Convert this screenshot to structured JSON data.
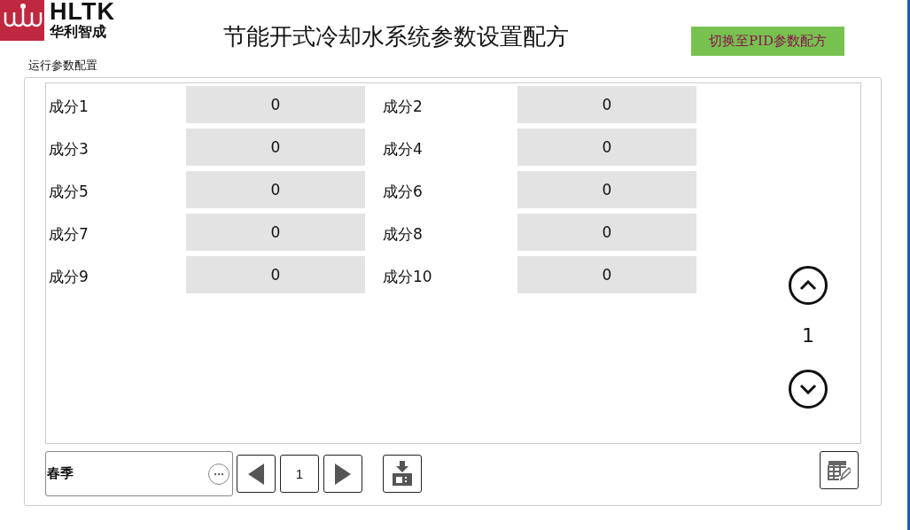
{
  "logo": {
    "brand": "HLTK",
    "subtitle": "华利智成"
  },
  "title": "节能开式冷却水系统参数设置配方",
  "switch_button": "切换至PID参数配方",
  "section_label": "运行参数配置",
  "params": [
    {
      "label": "成分1",
      "value": "0"
    },
    {
      "label": "成分2",
      "value": "0"
    },
    {
      "label": "成分3",
      "value": "0"
    },
    {
      "label": "成分4",
      "value": "0"
    },
    {
      "label": "成分5",
      "value": "0"
    },
    {
      "label": "成分6",
      "value": "0"
    },
    {
      "label": "成分7",
      "value": "0"
    },
    {
      "label": "成分8",
      "value": "0"
    },
    {
      "label": "成分9",
      "value": "0"
    },
    {
      "label": "成分10",
      "value": "0"
    }
  ],
  "scroll_page": "1",
  "recipe": {
    "value": "春季"
  },
  "pager": {
    "page": "1"
  }
}
